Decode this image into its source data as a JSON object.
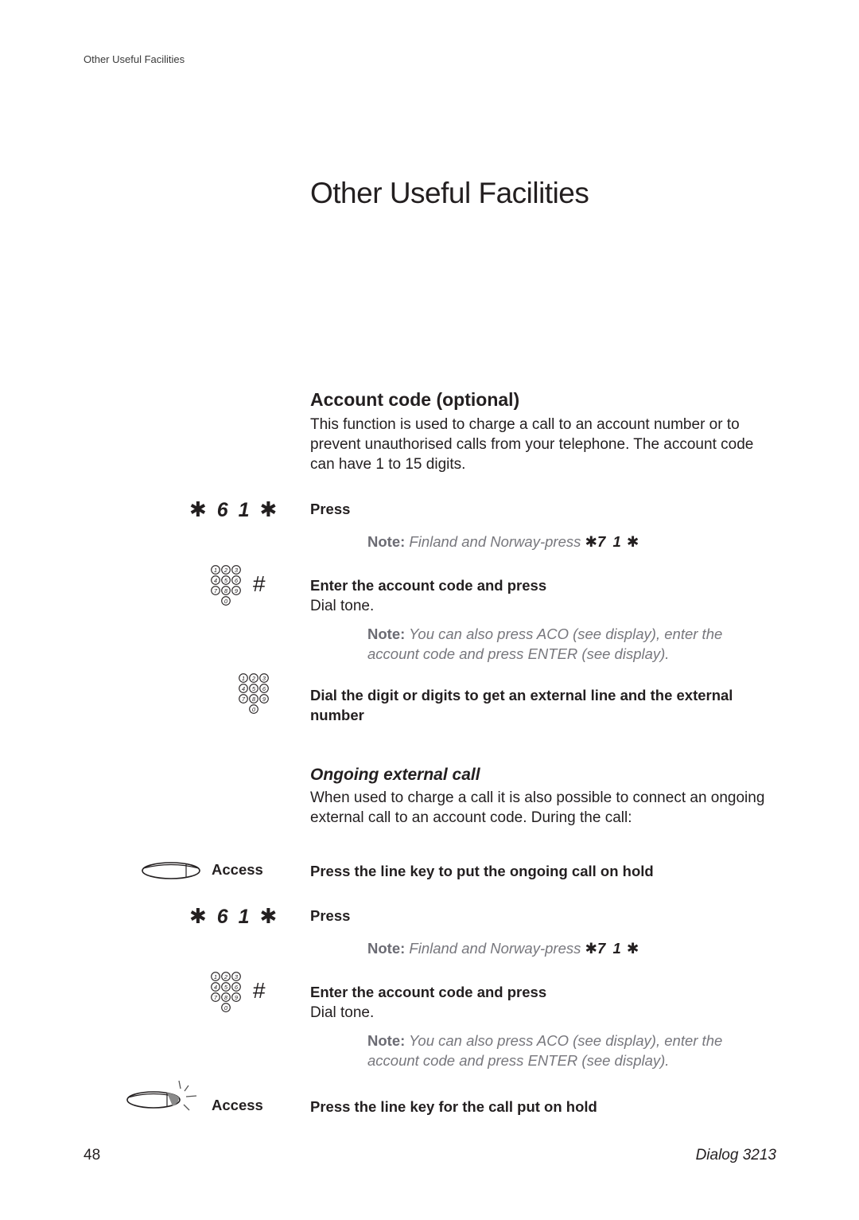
{
  "header": {
    "running_head": "Other Useful Facilities"
  },
  "chapter_title": "Other Useful Facilities",
  "section": {
    "title": "Account code (optional)",
    "intro": "This function is used to charge a call to an account number or to prevent unauthorised calls from your telephone. The account code can have 1 to 15 digits."
  },
  "steps_a": {
    "code_1": {
      "star_left": "✱",
      "digits": "6 1",
      "star_right": "✱"
    },
    "press_label": "Press",
    "note_1": {
      "label": "Note:",
      "text": "Finland and Norway-press",
      "star_left": "✱",
      "digits": "7 1",
      "star_right": "✱"
    },
    "hash_symbol": "#",
    "enter_code": "Enter the account code and press",
    "dial_tone": "Dial tone.",
    "note_2": {
      "label": "Note:",
      "text": "You can also press ACO (see display), enter the account code and press ENTER (see display)."
    },
    "dial_external": "Dial the digit or digits to get an external line and the external number"
  },
  "subsection": {
    "title": "Ongoing external call",
    "intro": "When used to charge a call it is also possible to connect an ongoing external call to an account code. During the call:"
  },
  "steps_b": {
    "access_label_1": "Access",
    "hold_instruction": "Press the line key to put the ongoing call on hold",
    "code_1": {
      "star_left": "✱",
      "digits": "6 1",
      "star_right": "✱"
    },
    "press_label": "Press",
    "note_1": {
      "label": "Note:",
      "text": "Finland and Norway-press",
      "star_left": "✱",
      "digits": "7 1",
      "star_right": "✱"
    },
    "hash_symbol": "#",
    "enter_code": "Enter the account code and press",
    "dial_tone": "Dial tone.",
    "note_2": {
      "label": "Note:",
      "text": "You can also press ACO (see display), enter the account code and press ENTER (see display)."
    },
    "access_label_2": "Access",
    "resume_instruction": "Press the line key for the call put on hold"
  },
  "keypad": {
    "keys": [
      "1",
      "2",
      "3",
      "4",
      "5",
      "6",
      "7",
      "8",
      "9",
      "0"
    ]
  },
  "footer": {
    "page_number": "48",
    "product": "Dialog 3213"
  }
}
